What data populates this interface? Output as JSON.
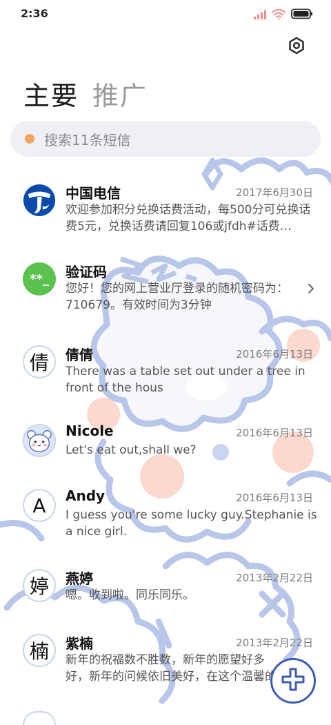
{
  "status": {
    "time": "2:36"
  },
  "tabs": [
    {
      "label": "主要"
    },
    {
      "label": "推广"
    }
  ],
  "search": {
    "placeholder": "搜索11条短信"
  },
  "conversations": [
    {
      "name": "中国电信",
      "date": "2017年6月30日",
      "preview": "欢迎参加积分兑换话费活动，每500分可兑换话费5元，兑换话费请回复106或jfdh#话费…",
      "avatar_type": "telecom-logo"
    },
    {
      "name": "验证码",
      "date": "",
      "preview": "您好！您的网上营业厅登录的随机密码为：710679。有效时间为3分钟",
      "avatar_type": "code-badge",
      "avatar_text": "**_"
    },
    {
      "name": "倩倩",
      "date": "2016年6月13日",
      "preview": "There was a table set out under a tree in front of the hous",
      "avatar_type": "letter",
      "avatar_text": "倩"
    },
    {
      "name": "Nicole",
      "date": "2016年6月13日",
      "preview": "Let's eat out,shall we?",
      "avatar_type": "photo"
    },
    {
      "name": "Andy",
      "date": "2016年6月13日",
      "preview": "I guess you're some lucky guy.Stephanie is a nice girl.",
      "avatar_type": "letter",
      "avatar_text": "A"
    },
    {
      "name": "燕婷",
      "date": "2013年2月22日",
      "preview": "嗯。收到啦。同乐同乐。",
      "avatar_type": "letter",
      "avatar_text": "婷"
    },
    {
      "name": "紫楠",
      "date": "2013年2月22日",
      "preview": "新年的祝福数不胜数，新年的愿望好多好，新年的问候依旧美好，在这个温馨的时",
      "avatar_type": "letter",
      "avatar_text": "楠"
    }
  ],
  "colors": {
    "accent": "#3d5bb5",
    "telecom": "#0a4aa8",
    "code_green": "#5cc24f",
    "search_dot": "#f4a462"
  }
}
